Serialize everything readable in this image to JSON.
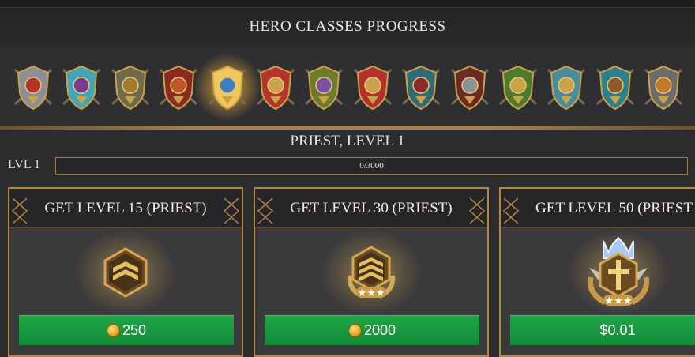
{
  "header": {
    "title": "HERO CLASSES PROGRESS"
  },
  "classes": [
    {
      "icon": "knight-crest-icon",
      "selected": false
    },
    {
      "icon": "mage-book-icon",
      "selected": false
    },
    {
      "icon": "archer-bow-icon",
      "selected": false
    },
    {
      "icon": "warrior-shield-icon",
      "selected": false
    },
    {
      "icon": "priest-holy-book-icon",
      "selected": true
    },
    {
      "icon": "berserker-claw-icon",
      "selected": false
    },
    {
      "icon": "druid-staff-icon",
      "selected": false
    },
    {
      "icon": "paladin-winged-shield-icon",
      "selected": false
    },
    {
      "icon": "viking-round-shield-icon",
      "selected": false
    },
    {
      "icon": "barbarian-axe-icon",
      "selected": false
    },
    {
      "icon": "beast-master-icon",
      "selected": false
    },
    {
      "icon": "scroll-banner-icon",
      "selected": false
    },
    {
      "icon": "rogue-crest-icon",
      "selected": false
    },
    {
      "icon": "engineer-mask-icon",
      "selected": false
    }
  ],
  "selected_class": {
    "title": "PRIEST, LEVEL 1"
  },
  "progress": {
    "label": "LVL 1",
    "text": "0/3000",
    "current": 0,
    "max": 3000
  },
  "rewards": [
    {
      "title": "GET LEVEL 15 (PRIEST)",
      "price": "250",
      "currency": "coin-icon",
      "emblem": "rank-chevron-emblem"
    },
    {
      "title": "GET LEVEL 30 (PRIEST)",
      "price": "2000",
      "currency": "coin-icon",
      "emblem": "rank-laurel-stars-emblem"
    },
    {
      "title": "GET LEVEL 50 (PRIEST",
      "price": "$0.01",
      "currency": "",
      "emblem": "rank-crown-sword-emblem"
    }
  ],
  "colors": {
    "accent_gold": "#b58746",
    "buy_green": "#1ea546",
    "background": "#2c2b2d"
  }
}
